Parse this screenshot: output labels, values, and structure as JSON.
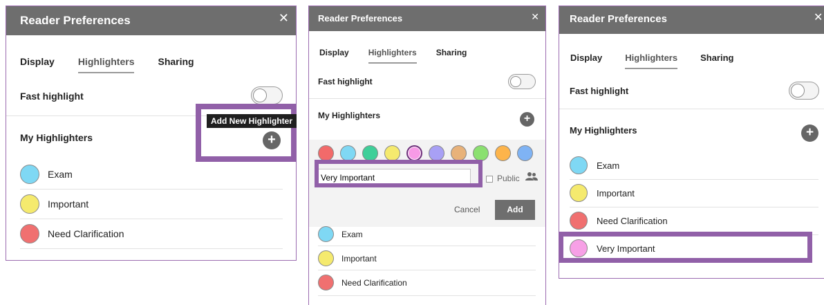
{
  "panel1": {
    "title": "Reader Preferences",
    "close": "✕",
    "tabs": [
      "Display",
      "Highlighters",
      "Sharing"
    ],
    "fast_highlight_label": "Fast highlight",
    "fast_highlight_on": false,
    "my_highlighters_label": "My Highlighters",
    "tooltip": "Add New Highlighter",
    "add_symbol": "+",
    "highlighters": [
      {
        "label": "Exam",
        "color": "#7fd8f4"
      },
      {
        "label": "Important",
        "color": "#f5ea6e"
      },
      {
        "label": "Need Clarification",
        "color": "#f07070"
      }
    ]
  },
  "panel2": {
    "title": "Reader Preferences",
    "close": "✕",
    "tabs": [
      "Display",
      "Highlighters",
      "Sharing"
    ],
    "fast_highlight_label": "Fast highlight",
    "fast_highlight_on": false,
    "my_highlighters_label": "My Highlighters",
    "add_symbol": "+",
    "palette": [
      "#f26a6a",
      "#7fd8f4",
      "#3fcf99",
      "#f5ea6e",
      "#f79ae6",
      "#a8a0f5",
      "#e8b27a",
      "#8be070",
      "#fdb44b",
      "#7fb3f4"
    ],
    "selected_color_index": 4,
    "name_input_value": "Very Important",
    "public_label": "Public",
    "public_icon": "group-icon",
    "cancel_label": "Cancel",
    "add_label": "Add",
    "highlighters": [
      {
        "label": "Exam",
        "color": "#7fd8f4"
      },
      {
        "label": "Important",
        "color": "#f5ea6e"
      },
      {
        "label": "Need Clarification",
        "color": "#f07070"
      }
    ]
  },
  "panel3": {
    "title": "Reader Preferences",
    "close": "✕",
    "tabs": [
      "Display",
      "Highlighters",
      "Sharing"
    ],
    "fast_highlight_label": "Fast highlight",
    "fast_highlight_on": false,
    "my_highlighters_label": "My Highlighters",
    "add_symbol": "+",
    "highlighters": [
      {
        "label": "Exam",
        "color": "#7fd8f4"
      },
      {
        "label": "Important",
        "color": "#f5ea6e"
      },
      {
        "label": "Need Clarification",
        "color": "#f07070"
      },
      {
        "label": "Very Important",
        "color": "#f7a0e6"
      }
    ]
  },
  "accent_color": "#9160a8",
  "header_color": "#6e6e6e"
}
